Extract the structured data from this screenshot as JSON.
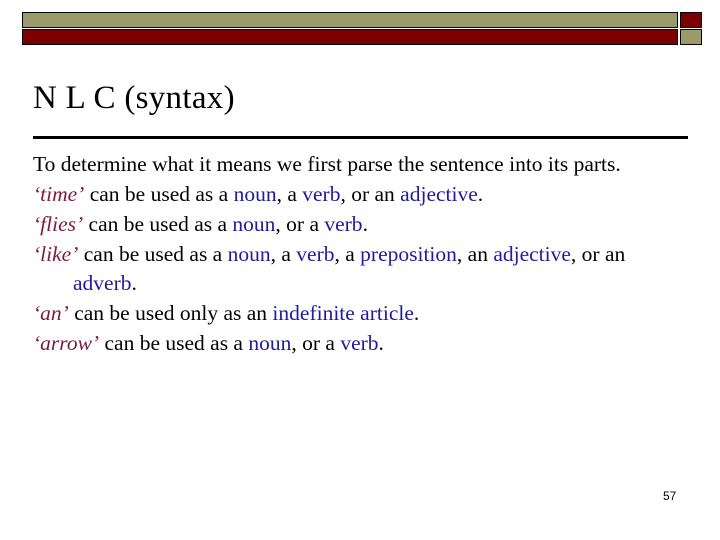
{
  "theme": {
    "bar_olive": "#9a9a6b",
    "bar_maroon": "#7b0000",
    "quoted_word_color": "#7b1c38",
    "part_of_speech_color": "#211a9e",
    "text_color": "#000000",
    "background": "#ffffff"
  },
  "header": {
    "decoration_name": "two-tone-bar-banner"
  },
  "title": "N L C (syntax)",
  "body": {
    "paragraphs": [
      {
        "id": "intro",
        "segments": [
          {
            "text": "To determine what it means we first parse the sentence into its parts.",
            "style": "plain"
          }
        ]
      },
      {
        "id": "time",
        "segments": [
          {
            "text": "‘time’",
            "style": "quoted"
          },
          {
            "text": " can be used as a ",
            "style": "plain"
          },
          {
            "text": "noun",
            "style": "pos"
          },
          {
            "text": ", a ",
            "style": "plain"
          },
          {
            "text": "verb",
            "style": "pos"
          },
          {
            "text": ", or an ",
            "style": "plain"
          },
          {
            "text": "adjective",
            "style": "pos"
          },
          {
            "text": ".",
            "style": "plain"
          }
        ]
      },
      {
        "id": "flies",
        "segments": [
          {
            "text": "‘flies’",
            "style": "quoted"
          },
          {
            "text": " can be used as a ",
            "style": "plain"
          },
          {
            "text": "noun",
            "style": "pos"
          },
          {
            "text": ", or a ",
            "style": "plain"
          },
          {
            "text": "verb",
            "style": "pos"
          },
          {
            "text": ".",
            "style": "plain"
          }
        ]
      },
      {
        "id": "like",
        "segments": [
          {
            "text": "‘like’",
            "style": "quoted"
          },
          {
            "text": " can be used as a ",
            "style": "plain"
          },
          {
            "text": "noun",
            "style": "pos"
          },
          {
            "text": ", a ",
            "style": "plain"
          },
          {
            "text": "verb",
            "style": "pos"
          },
          {
            "text": ", a ",
            "style": "plain"
          },
          {
            "text": "preposition",
            "style": "pos"
          },
          {
            "text": ", an ",
            "style": "plain"
          },
          {
            "text": "adjective",
            "style": "pos"
          },
          {
            "text": ", or an ",
            "style": "plain"
          },
          {
            "text": "adverb",
            "style": "pos"
          },
          {
            "text": ".",
            "style": "plain"
          }
        ]
      },
      {
        "id": "an",
        "segments": [
          {
            "text": "‘an’",
            "style": "quoted"
          },
          {
            "text": " can be used only as an ",
            "style": "plain"
          },
          {
            "text": "indefinite article",
            "style": "pos"
          },
          {
            "text": ".",
            "style": "plain"
          }
        ]
      },
      {
        "id": "arrow",
        "segments": [
          {
            "text": "‘arrow’",
            "style": "quoted"
          },
          {
            "text": " can be used as a ",
            "style": "plain"
          },
          {
            "text": "noun",
            "style": "pos"
          },
          {
            "text": ", or a ",
            "style": "plain"
          },
          {
            "text": "verb",
            "style": "pos"
          },
          {
            "text": ".",
            "style": "plain"
          }
        ]
      }
    ]
  },
  "page_number": "57"
}
